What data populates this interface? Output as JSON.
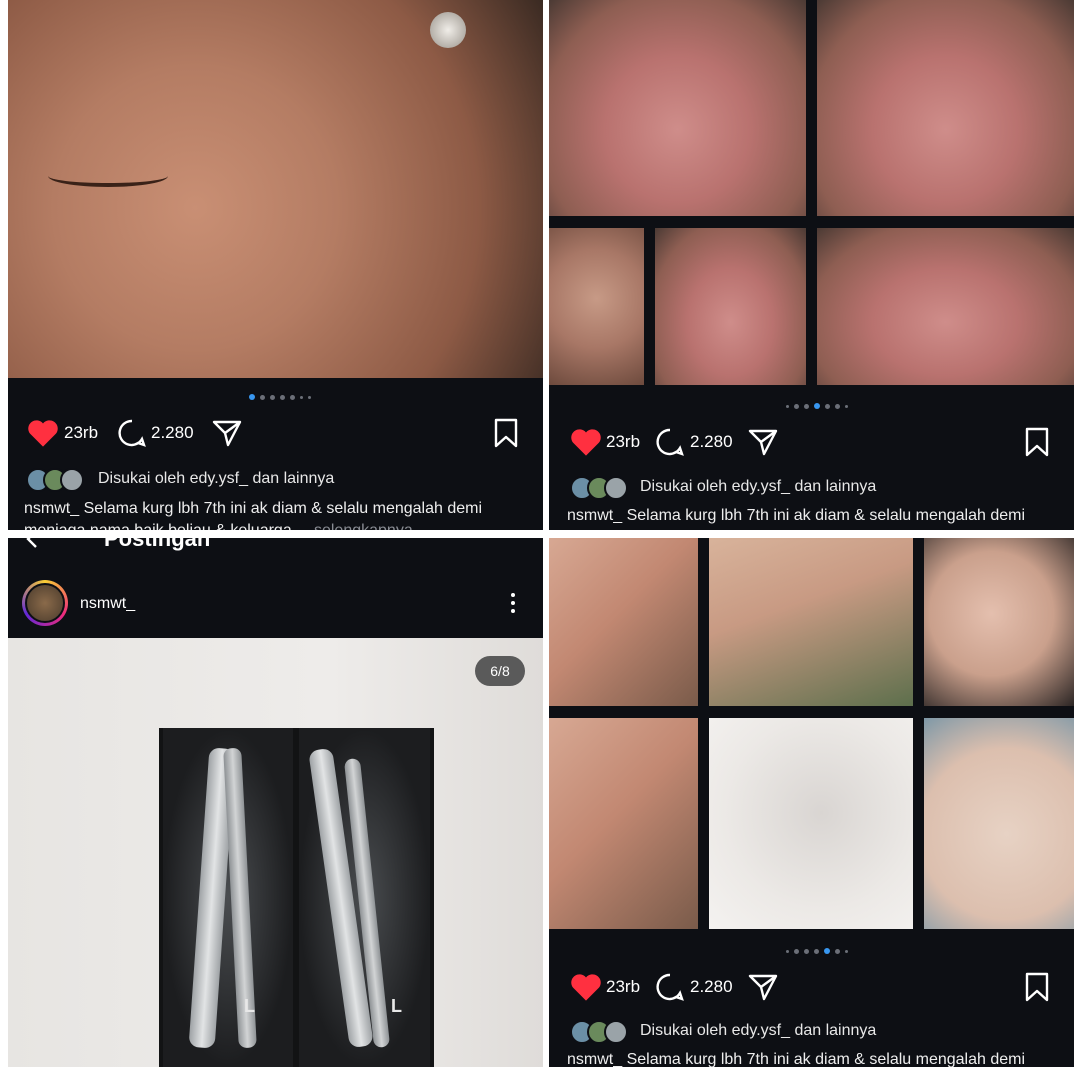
{
  "post": {
    "likes": "23rb",
    "comments": "2.280",
    "liked_by": "Disukai oleh edy.ysf_ dan lainnya",
    "caption_main": "nsmwt_ Selama kurg lbh 7th ini ak diam & selalu mengalah demi",
    "caption_line2": "menjaga nama baik beliau & keluarga",
    "caption_more": "... selengkapnya",
    "caption_bottom": "nsmwt_ Selama kurg lbh 7th ini ak diam & selalu mengalah demi"
  },
  "viewer": {
    "header_title": "Postingan",
    "username": "nsmwt_",
    "page_counter": "6/8",
    "xray_label_left": "L",
    "xray_label_right": "L"
  },
  "colors": {
    "background": "#0d0f14",
    "heart": "#ff3040",
    "active_dot": "#3897f0"
  },
  "icons": [
    "heart-icon",
    "comment-icon",
    "share-icon",
    "bookmark-icon",
    "more-icon",
    "back-arrow-icon"
  ]
}
